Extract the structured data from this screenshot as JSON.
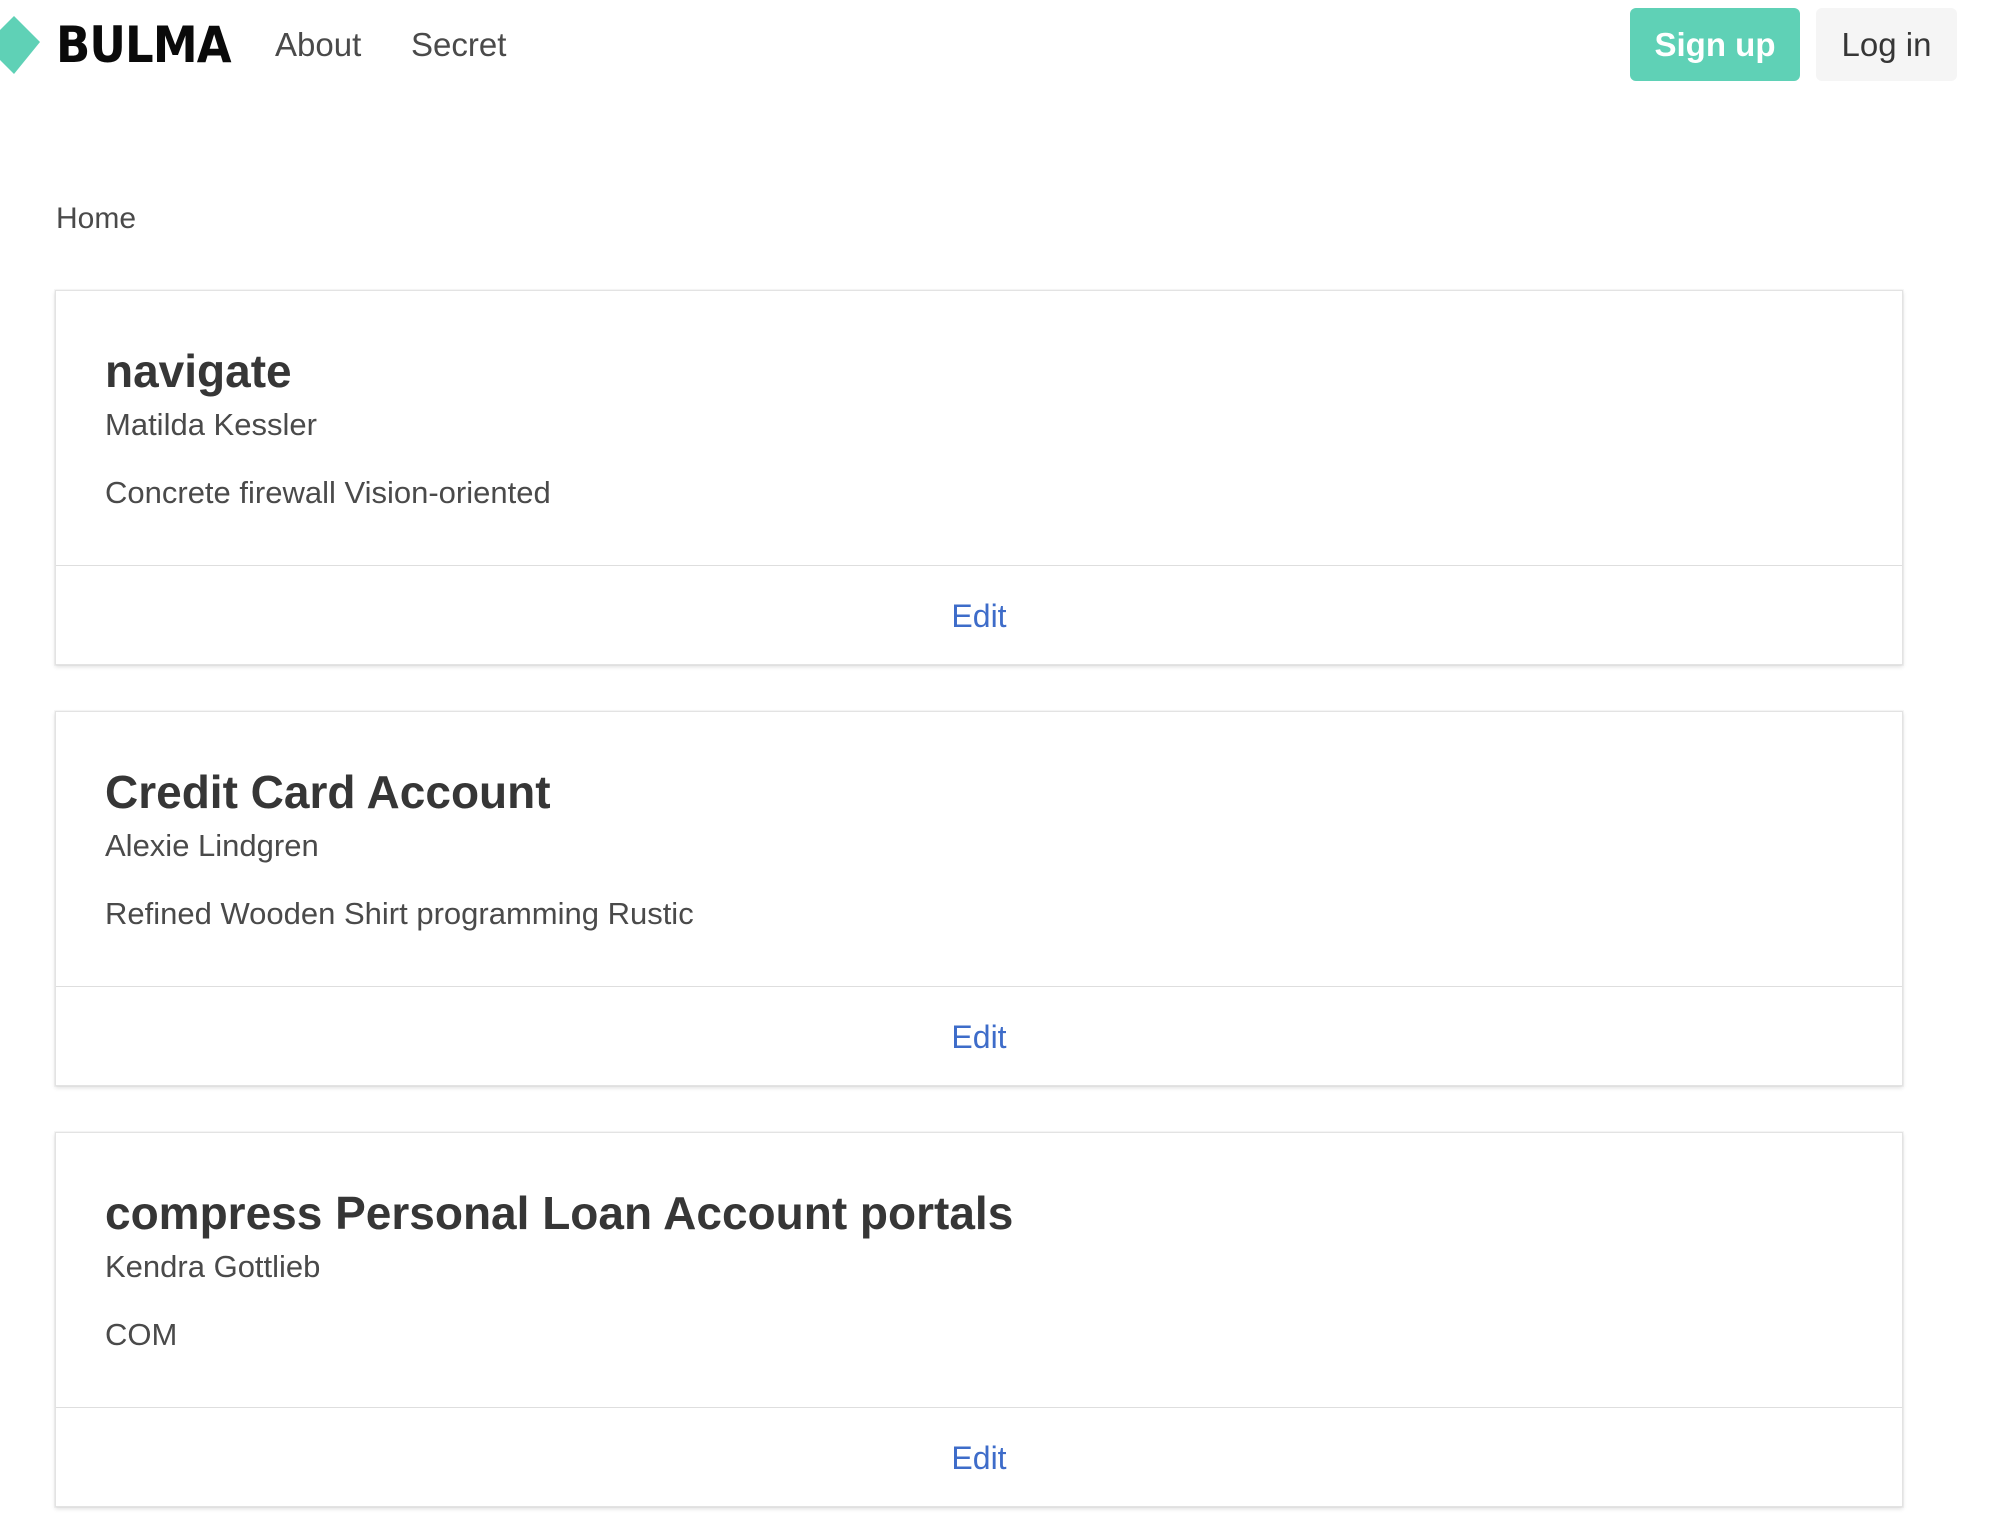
{
  "navbar": {
    "brand": "BULMA",
    "brand_color": "#5fd1b6",
    "links": [
      {
        "label": "About"
      },
      {
        "label": "Secret"
      }
    ],
    "signup_label": "Sign up",
    "login_label": "Log in"
  },
  "breadcrumb": {
    "current": "Home"
  },
  "cards": [
    {
      "title": "navigate",
      "subtitle": "Matilda Kessler",
      "content": "Concrete firewall Vision-oriented",
      "footer_action": "Edit"
    },
    {
      "title": "Credit Card Account",
      "subtitle": "Alexie Lindgren",
      "content": "Refined Wooden Shirt programming Rustic",
      "footer_action": "Edit"
    },
    {
      "title": "compress Personal Loan Account portals",
      "subtitle": "Kendra Gottlieb",
      "content": "COM",
      "footer_action": "Edit"
    }
  ],
  "colors": {
    "primary": "#5fd1b6",
    "link": "#3e6cc9",
    "text": "#363636"
  }
}
